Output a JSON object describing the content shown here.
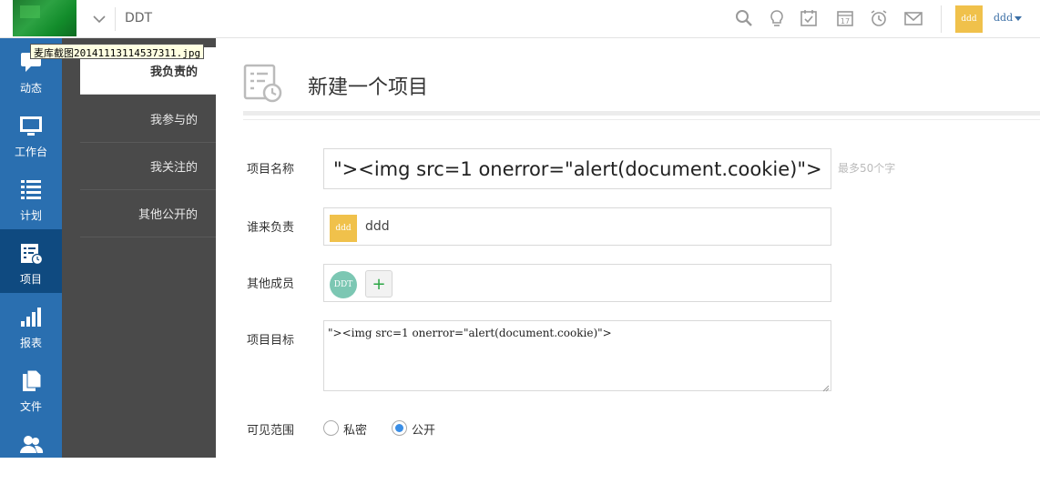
{
  "topbar": {
    "project_name": "DDT",
    "icons": [
      "search-icon",
      "lightbulb-icon",
      "task-check-icon",
      "calendar-icon",
      "alarm-icon",
      "mail-icon"
    ],
    "calendar_day": "17",
    "avatar_text": "ddd",
    "user_name": "ddd"
  },
  "tooltip": "麦库截图20141113114537311.jpg",
  "nav": {
    "items": [
      {
        "label": "动态",
        "icon": "chat-icon"
      },
      {
        "label": "工作台",
        "icon": "monitor-icon"
      },
      {
        "label": "计划",
        "icon": "list-icon"
      },
      {
        "label": "项目",
        "icon": "project-icon"
      },
      {
        "label": "报表",
        "icon": "bar-chart-icon"
      },
      {
        "label": "文件",
        "icon": "file-icon"
      },
      {
        "label": "",
        "icon": "people-icon"
      }
    ],
    "active_index": 3
  },
  "subnav": {
    "items": [
      "我负责的",
      "我参与的",
      "我关注的",
      "其他公开的"
    ],
    "active_index": 0
  },
  "main": {
    "title": "新建一个项目",
    "form": {
      "name_label": "项目名称",
      "name_value": "\"><img src=1 onerror=\"alert(document.cookie)\">",
      "name_hint": "最多50个字",
      "owner_label": "谁来负责",
      "owner_avatar": "ddd",
      "owner_name": "ddd",
      "members_label": "其他成员",
      "member_avatar": "DDT",
      "add_member": "+",
      "goal_label": "项目目标",
      "goal_value": "\"><img src=1 onerror=\"alert(document.cookie)\">",
      "visibility_label": "可见范围",
      "visibility_options": [
        "私密",
        "公开"
      ],
      "visibility_selected": "公开"
    }
  },
  "colors": {
    "nav_bg": "#2a6fb0",
    "nav_active": "#0f4a80",
    "subnav_bg": "#4a4a4a",
    "accent": "#3a8ee6",
    "avatar_yellow": "#f0c14b",
    "avatar_teal": "#7cc7b3"
  }
}
